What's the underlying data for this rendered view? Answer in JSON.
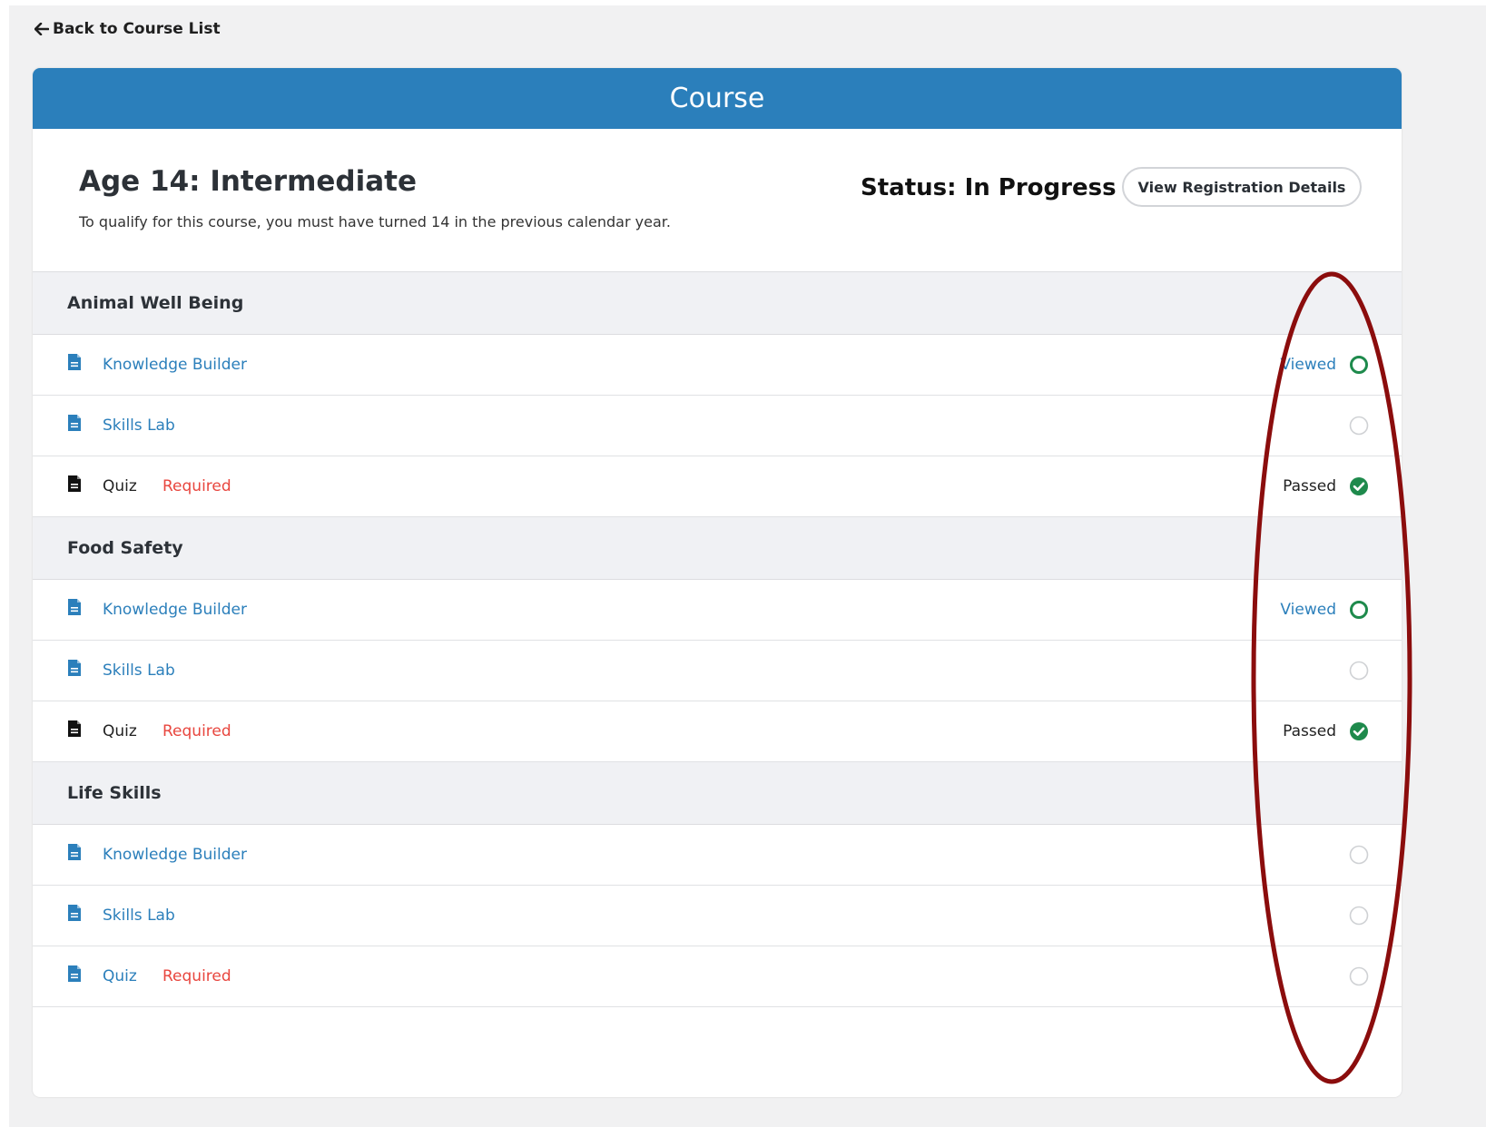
{
  "nav": {
    "back_label": "Back to Course List"
  },
  "header": {
    "title": "Course"
  },
  "course": {
    "title": "Age 14: Intermediate",
    "description": "To qualify for this course, you must have turned 14 in the previous calendar year.",
    "status": "Status: In Progress",
    "registration_button": "View Registration Details"
  },
  "colors": {
    "header_bg": "#2b7fbb",
    "link": "#2b7fbb",
    "required": "#e8463e",
    "success": "#1e8a4c",
    "annotation": "#8b0d0d"
  },
  "sections": [
    {
      "title": "Animal Well Being",
      "items": [
        {
          "label": "Knowledge Builder",
          "icon": "document-icon",
          "style": "link",
          "required": "",
          "status": "Viewed",
          "status_icon": "circle-outline-green-icon"
        },
        {
          "label": "Skills Lab",
          "icon": "document-icon",
          "style": "link",
          "required": "",
          "status": "",
          "status_icon": "circle-empty-icon"
        },
        {
          "label": "Quiz",
          "icon": "document-icon",
          "style": "dark",
          "required": "Required",
          "status": "Passed",
          "status_icon": "check-circle-icon"
        }
      ]
    },
    {
      "title": "Food Safety",
      "items": [
        {
          "label": "Knowledge Builder",
          "icon": "document-icon",
          "style": "link",
          "required": "",
          "status": "Viewed",
          "status_icon": "circle-outline-green-icon"
        },
        {
          "label": "Skills Lab",
          "icon": "document-icon",
          "style": "link",
          "required": "",
          "status": "",
          "status_icon": "circle-empty-icon"
        },
        {
          "label": "Quiz",
          "icon": "document-icon",
          "style": "dark",
          "required": "Required",
          "status": "Passed",
          "status_icon": "check-circle-icon"
        }
      ]
    },
    {
      "title": "Life Skills",
      "items": [
        {
          "label": "Knowledge Builder",
          "icon": "document-icon",
          "style": "link",
          "required": "",
          "status": "",
          "status_icon": "circle-empty-icon"
        },
        {
          "label": "Skills Lab",
          "icon": "document-icon",
          "style": "link",
          "required": "",
          "status": "",
          "status_icon": "circle-empty-icon"
        },
        {
          "label": "Quiz",
          "icon": "document-icon",
          "style": "link",
          "required": "Required",
          "status": "",
          "status_icon": "circle-empty-icon"
        }
      ]
    }
  ]
}
